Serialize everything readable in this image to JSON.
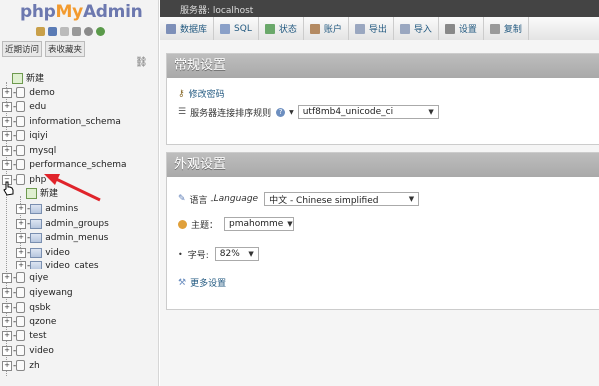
{
  "logo": {
    "php": "php",
    "my": "My",
    "admin": "Admin"
  },
  "recent_tabs": [
    "近期访问",
    "表收藏夹"
  ],
  "tree": {
    "new_label": "新建",
    "databases": [
      "demo",
      "edu",
      "information_schema",
      "iqiyi",
      "mysql",
      "performance_schema",
      "php"
    ],
    "php_children": {
      "new_label": "新建",
      "tables": [
        "admins",
        "admin_groups",
        "admin_menus",
        "video",
        "video_cates"
      ]
    },
    "databases_after": [
      "qiye",
      "qiyewang",
      "qsbk",
      "qzone",
      "test",
      "video",
      "zh"
    ]
  },
  "topbar": {
    "server": "服务器: localhost"
  },
  "nav_tabs": [
    {
      "label": "数据库",
      "icon": "database-icon",
      "color": "#7d8fb8"
    },
    {
      "label": "SQL",
      "icon": "sql-icon",
      "color": "#8aa0c8"
    },
    {
      "label": "状态",
      "icon": "status-icon",
      "color": "#6aa86a"
    },
    {
      "label": "账户",
      "icon": "users-icon",
      "color": "#b48a62"
    },
    {
      "label": "导出",
      "icon": "export-icon",
      "color": "#9aa7c0"
    },
    {
      "label": "导入",
      "icon": "import-icon",
      "color": "#9aa7c0"
    },
    {
      "label": "设置",
      "icon": "wrench-icon",
      "color": "#888888"
    },
    {
      "label": "复制",
      "icon": "replication-icon",
      "color": "#999999"
    }
  ],
  "general": {
    "title": "常规设置",
    "change_password": "修改密码",
    "collation_label": "服务器连接排序规则",
    "collation_value": "utf8mb4_unicode_ci"
  },
  "appearance": {
    "title": "外观设置",
    "language_label": "语言 - ",
    "language_italic": "Language",
    "language_value": "中文 - Chinese simplified",
    "theme_label": "主题：",
    "theme_value": "pmahomme",
    "fontsize_label": "字号:",
    "fontsize_value": "82%",
    "more_settings": "更多设置"
  },
  "colors": {
    "accent_link": "#235a81",
    "arrow": "#e0242b",
    "group_header": "#b3b3b3"
  }
}
